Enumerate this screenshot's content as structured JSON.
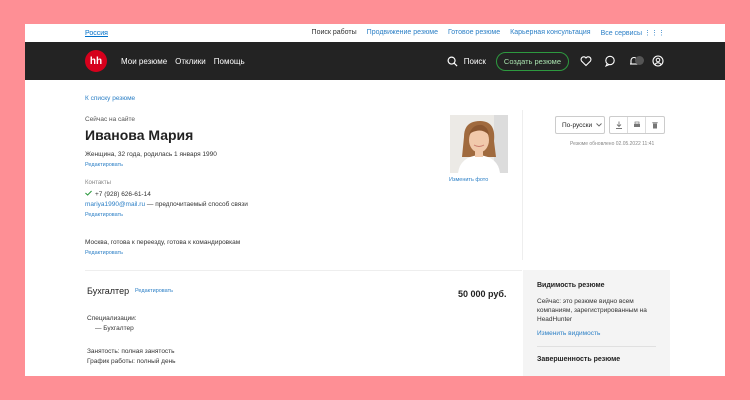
{
  "topbar": {
    "region": "Россия",
    "links": [
      "Поиск работы",
      "Продвижение резюме",
      "Готовое резюме",
      "Карьерная консультация",
      "Все сервисы"
    ]
  },
  "navbar": {
    "logo": "hh",
    "items": [
      "Мои резюме",
      "Отклики",
      "Помощь"
    ],
    "search_label": "Поиск",
    "create_label": "Создать резюме"
  },
  "resume": {
    "back_link": "К списку резюме",
    "status": "Сейчас на сайте",
    "name": "Иванова Мария",
    "bio": "Женщина, 32 года, родилась 1 января 1990",
    "edit_label": "Редактировать",
    "contacts_label": "Контакты",
    "phone": "+7 (928) 626-61-14",
    "email": "mariya1990@mail.ru",
    "email_note": " — предпочитаемый способ связи",
    "city": "Москва, готова к переезду, готова к командировкам",
    "change_photo": "Изменить фото",
    "language_button": "По-русски",
    "updated": "Резюме обновлено 02.05.2022 11:41"
  },
  "position": {
    "title": "Бухгалтер",
    "edit_label": "Редактировать",
    "salary": "50 000 руб.",
    "specializations_label": "Специализации:",
    "specialization": "— Бухгалтер",
    "employment": "Занятость: полная занятость",
    "schedule": "График работы: полный день"
  },
  "sidebar": {
    "visibility_title": "Видимость резюме",
    "visibility_text": "Сейчас: это резюме видно всем компаниям, зарегистрированным на HeadHunter",
    "visibility_link": "Изменить видимость",
    "completeness_title": "Завершенность резюме"
  },
  "colors": {
    "background": "#fe8f95",
    "navbar": "#232323",
    "logo": "#d6001c",
    "link": "#2b7fc6",
    "accent_green": "#2d9a3f"
  }
}
